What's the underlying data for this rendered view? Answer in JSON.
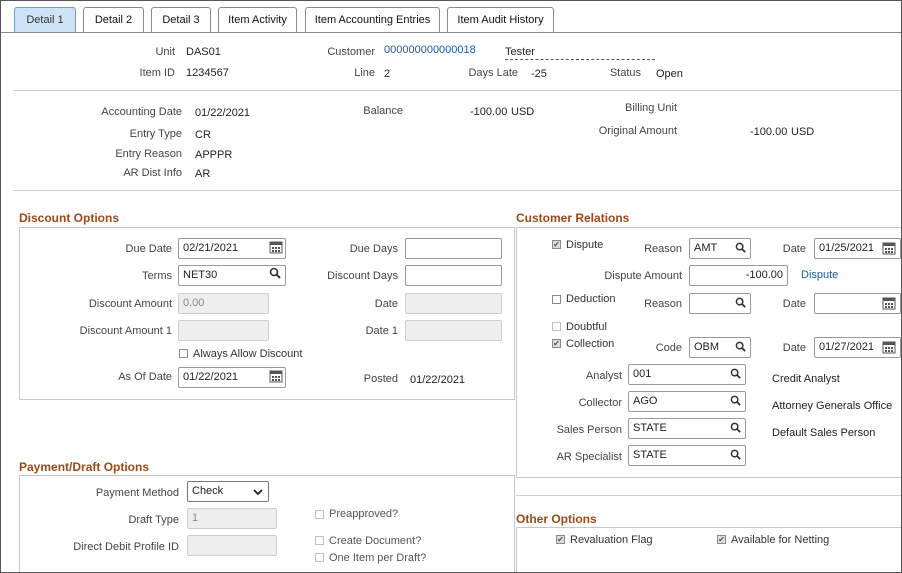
{
  "tabs": [
    {
      "label": "Detail 1",
      "active": true
    },
    {
      "label": "Detail 2",
      "active": false
    },
    {
      "label": "Detail 3",
      "active": false
    },
    {
      "label": "Item Activity",
      "active": false
    },
    {
      "label": "Item Accounting Entries",
      "active": false
    },
    {
      "label": "Item Audit History",
      "active": false
    }
  ],
  "header": {
    "unit_label": "Unit",
    "unit": "DAS01",
    "customer_label": "Customer",
    "customer_id": "000000000000018",
    "customer_name": "Tester",
    "item_id_label": "Item ID",
    "item_id": "1234567",
    "line_label": "Line",
    "line": "2",
    "days_late_label": "Days Late",
    "days_late": "-25",
    "status_label": "Status",
    "status": "Open"
  },
  "accounting": {
    "accounting_date_label": "Accounting Date",
    "accounting_date": "01/22/2021",
    "balance_label": "Balance",
    "balance": "-100.00",
    "balance_currency": "USD",
    "billing_unit_label": "Billing Unit",
    "entry_type_label": "Entry Type",
    "entry_type": "CR",
    "original_amount_label": "Original Amount",
    "original_amount": "-100.00",
    "original_currency": "USD",
    "entry_reason_label": "Entry Reason",
    "entry_reason": "APPPR",
    "ar_dist_label": "AR Dist Info",
    "ar_dist": "AR"
  },
  "discount": {
    "title": "Discount Options",
    "due_date_label": "Due Date",
    "due_date": "02/21/2021",
    "due_days_label": "Due Days",
    "due_days": "",
    "terms_label": "Terms",
    "terms": "NET30",
    "discount_days_label": "Discount Days",
    "discount_days": "",
    "discount_amount_label": "Discount Amount",
    "discount_amount": "0.00",
    "date_label": "Date",
    "date": "",
    "discount_amount1_label": "Discount Amount 1",
    "discount_amount1": "",
    "date1_label": "Date 1",
    "date1": "",
    "always_allow_label": "Always Allow Discount",
    "always_allow": false,
    "as_of_date_label": "As Of Date",
    "as_of_date": "01/22/2021",
    "posted_label": "Posted",
    "posted": "01/22/2021"
  },
  "customer_relations": {
    "title": "Customer Relations",
    "dispute_label": "Dispute",
    "dispute_checked": true,
    "reason_label": "Reason",
    "dispute_reason": "AMT",
    "date_label": "Date",
    "dispute_date": "01/25/2021",
    "dispute_amount_label": "Dispute Amount",
    "dispute_amount": "-100.00",
    "dispute_link": "Dispute",
    "deduction_label": "Deduction",
    "deduction_checked": false,
    "deduction_reason": "",
    "deduction_date": "",
    "doubtful_label": "Doubtful",
    "doubtful_checked": false,
    "collection_label": "Collection",
    "collection_checked": true,
    "code_label": "Code",
    "collection_code": "OBM",
    "collection_date": "01/27/2021",
    "analyst_label": "Analyst",
    "analyst": "001",
    "analyst_desc": "Credit Analyst",
    "collector_label": "Collector",
    "collector": "AGO",
    "collector_desc": "Attorney Generals Office",
    "sales_person_label": "Sales Person",
    "sales_person": "STATE",
    "sales_person_desc": "Default Sales Person",
    "ar_specialist_label": "AR Specialist",
    "ar_specialist": "STATE"
  },
  "payment": {
    "title": "Payment/Draft Options",
    "method_label": "Payment Method",
    "method": "Check",
    "draft_type_label": "Draft Type",
    "draft_type": "1",
    "direct_debit_label": "Direct Debit Profile ID",
    "direct_debit": "",
    "preapproved_label": "Preapproved?",
    "create_document_label": "Create Document?",
    "one_item_label": "One Item per Draft?"
  },
  "other": {
    "title": "Other Options",
    "revaluation_label": "Revaluation Flag",
    "revaluation_checked": true,
    "netting_label": "Available for Netting",
    "netting_checked": true
  }
}
